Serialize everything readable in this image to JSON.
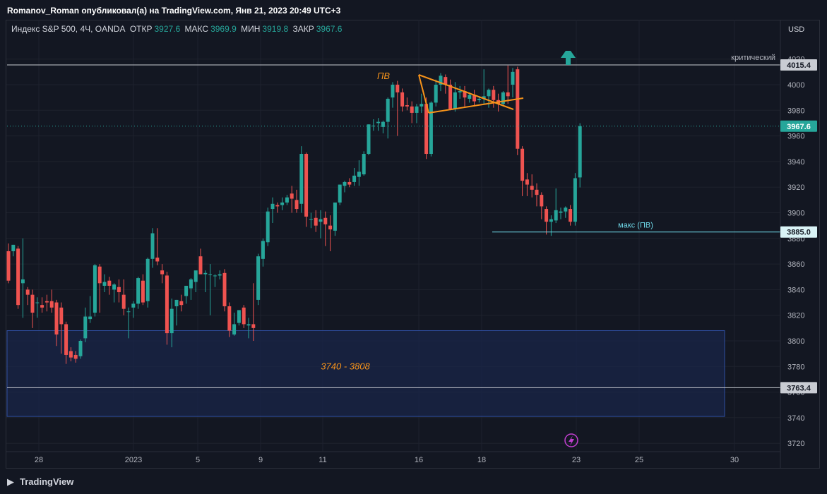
{
  "header": {
    "publish_line": "Romanov_Roman опубликовал(а) на TradingView.com, Янв 21, 2023 20:49 UTC+3"
  },
  "legend": {
    "symbol": "Индекс S&P 500, 4Ч, OANDA",
    "open_label": "ОТКР",
    "open_value": "3927.6",
    "high_label": "МАКС",
    "high_value": "3969.9",
    "low_label": "МИН",
    "low_value": "3919.8",
    "close_label": "ЗАКР",
    "close_value": "3967.6"
  },
  "footer": {
    "brand": "TradingView"
  },
  "colors": {
    "up": "#26a69a",
    "down": "#ef5350",
    "orange": "#f7931a",
    "zone_fill": "#1a2548",
    "zone_border": "#2f4ea0",
    "cyan": "#6fd8e8"
  },
  "chart_data": {
    "type": "candlestick",
    "currency": "USD",
    "ylim": [
      3712,
      4034
    ],
    "y_ticks": [
      3720,
      3740,
      3760,
      3780,
      3800,
      3820,
      3840,
      3860,
      3880,
      3900,
      3920,
      3940,
      3960,
      3980,
      4000,
      4020
    ],
    "x_ticks": [
      "28",
      "2023",
      "5",
      "9",
      "11",
      "16",
      "18",
      "23",
      "25",
      "30"
    ],
    "current_price": "3967.6",
    "levels": [
      {
        "name": "critical",
        "price": 4015.4,
        "label": "критический",
        "tag": "4015.4"
      },
      {
        "name": "max-pv",
        "price": 3885.0,
        "label": "макс (ПВ)",
        "tag": "3885.0"
      },
      {
        "name": "zone-bottom",
        "price": 3763.4,
        "label": "",
        "tag": "3763.4"
      }
    ],
    "zone": {
      "low": 3741,
      "high": 3808,
      "label": "3740 - 3808"
    },
    "triangle_label": "ПВ",
    "candles": [
      [
        3870,
        3876,
        3845,
        3847
      ],
      [
        3870,
        3875,
        3866,
        3875
      ],
      [
        3872,
        3874,
        3825,
        3828
      ],
      [
        3845,
        3880,
        3818,
        3848
      ],
      [
        3840,
        3842,
        3828,
        3836
      ],
      [
        3836,
        3840,
        3810,
        3822
      ],
      [
        3830,
        3834,
        3818,
        3830
      ],
      [
        3828,
        3834,
        3822,
        3826
      ],
      [
        3831,
        3836,
        3823,
        3830
      ],
      [
        3831,
        3840,
        3822,
        3826
      ],
      [
        3830,
        3832,
        3796,
        3805
      ],
      [
        3826,
        3830,
        3790,
        3813
      ],
      [
        3813,
        3815,
        3782,
        3789
      ],
      [
        3792,
        3795,
        3784,
        3787
      ],
      [
        3789,
        3792,
        3783,
        3786
      ],
      [
        3788,
        3801,
        3786,
        3800
      ],
      [
        3802,
        3826,
        3799,
        3819
      ],
      [
        3817,
        3835,
        3814,
        3819
      ],
      [
        3822,
        3860,
        3819,
        3859
      ],
      [
        3858,
        3860,
        3822,
        3845
      ],
      [
        3843,
        3852,
        3838,
        3846
      ],
      [
        3847,
        3850,
        3836,
        3843
      ],
      [
        3840,
        3845,
        3830,
        3844
      ],
      [
        3842,
        3848,
        3830,
        3838
      ],
      [
        3836,
        3848,
        3820,
        3825
      ],
      [
        3823,
        3826,
        3802,
        3823
      ],
      [
        3826,
        3831,
        3818,
        3829
      ],
      [
        3829,
        3850,
        3825,
        3849
      ],
      [
        3847,
        3852,
        3828,
        3830
      ],
      [
        3831,
        3865,
        3826,
        3864
      ],
      [
        3864,
        3888,
        3857,
        3884
      ],
      [
        3865,
        3888,
        3859,
        3862
      ],
      [
        3855,
        3860,
        3845,
        3852
      ],
      [
        3851,
        3854,
        3797,
        3806
      ],
      [
        3806,
        3833,
        3795,
        3825
      ],
      [
        3827,
        3832,
        3812,
        3832
      ],
      [
        3831,
        3836,
        3823,
        3828
      ],
      [
        3835,
        3843,
        3829,
        3843
      ],
      [
        3841,
        3849,
        3832,
        3848
      ],
      [
        3846,
        3854,
        3838,
        3855
      ],
      [
        3866,
        3872,
        3852,
        3852
      ],
      [
        3852,
        3855,
        3838,
        3853
      ],
      [
        3852,
        3860,
        3820,
        3852
      ],
      [
        3851,
        3852,
        3842,
        3851
      ],
      [
        3851,
        3855,
        3848,
        3852
      ],
      [
        3853,
        3856,
        3823,
        3827
      ],
      [
        3827,
        3830,
        3803,
        3808
      ],
      [
        3805,
        3822,
        3804,
        3813
      ],
      [
        3814,
        3824,
        3812,
        3824
      ],
      [
        3826,
        3828,
        3810,
        3813
      ],
      [
        3812,
        3818,
        3802,
        3813
      ],
      [
        3813,
        3845,
        3800,
        3810
      ],
      [
        3832,
        3868,
        3828,
        3866
      ],
      [
        3864,
        3880,
        3858,
        3878
      ],
      [
        3877,
        3904,
        3874,
        3901
      ],
      [
        3903,
        3912,
        3892,
        3907
      ],
      [
        3906,
        3908,
        3900,
        3905
      ],
      [
        3906,
        3912,
        3902,
        3908
      ],
      [
        3908,
        3914,
        3906,
        3912
      ],
      [
        3915,
        3921,
        3900,
        3911
      ],
      [
        3910,
        3918,
        3900,
        3903
      ],
      [
        3907,
        3952,
        3900,
        3946
      ],
      [
        3946,
        3947,
        3889,
        3897
      ],
      [
        3895,
        3900,
        3888,
        3895
      ],
      [
        3896,
        3902,
        3885,
        3890
      ],
      [
        3893,
        3902,
        3880,
        3895
      ],
      [
        3896,
        3901,
        3874,
        3891
      ],
      [
        3890,
        3898,
        3870,
        3887
      ],
      [
        3886,
        3908,
        3882,
        3908
      ],
      [
        3908,
        3922,
        3906,
        3922
      ],
      [
        3921,
        3925,
        3916,
        3924
      ],
      [
        3924,
        3927,
        3920,
        3922
      ],
      [
        3924,
        3935,
        3921,
        3929
      ],
      [
        3928,
        3941,
        3921,
        3932
      ],
      [
        3930,
        3948,
        3929,
        3946
      ],
      [
        3946,
        3969,
        3945,
        3969
      ],
      [
        3968,
        3973,
        3964,
        3968
      ],
      [
        3970,
        3974,
        3964,
        3971
      ],
      [
        3967,
        3972,
        3962,
        3971
      ],
      [
        3971,
        3990,
        3958,
        3989
      ],
      [
        3990,
        4002,
        3982,
        4000
      ],
      [
        4000,
        4003,
        3960,
        3994
      ],
      [
        3994,
        3997,
        3979,
        3983
      ],
      [
        3984,
        3990,
        3980,
        3983
      ],
      [
        3983,
        3987,
        3970,
        3978
      ],
      [
        3978,
        3985,
        3970,
        3983
      ],
      [
        3983,
        3993,
        3978,
        3985
      ],
      [
        3985,
        3990,
        3942,
        3946
      ],
      [
        3946,
        3987,
        3944,
        3986
      ],
      [
        3986,
        4004,
        3983,
        4000
      ],
      [
        4000,
        4009,
        3995,
        4007
      ],
      [
        4006,
        4008,
        3993,
        4000
      ],
      [
        4000,
        4004,
        3980,
        3981
      ],
      [
        3981,
        4002,
        3979,
        3994
      ],
      [
        3994,
        3999,
        3989,
        3995
      ],
      [
        3995,
        3999,
        3983,
        3990
      ],
      [
        3989,
        3994,
        3986,
        3992
      ],
      [
        3992,
        3996,
        3983,
        3987
      ],
      [
        3988,
        3991,
        3986,
        3989
      ],
      [
        3989,
        4012,
        3985,
        3991
      ],
      [
        3991,
        3997,
        3982,
        3996
      ],
      [
        3996,
        3999,
        3982,
        3988
      ],
      [
        3988,
        3993,
        3979,
        3985
      ],
      [
        3985,
        3995,
        3984,
        3994
      ],
      [
        3994,
        4015,
        3985,
        3991
      ],
      [
        4000,
        4013,
        3990,
        4010
      ],
      [
        4012,
        4014,
        3945,
        3950
      ],
      [
        3950,
        3952,
        3913,
        3925
      ],
      [
        3926,
        3931,
        3913,
        3922
      ],
      [
        3921,
        3930,
        3912,
        3918
      ],
      [
        3918,
        3923,
        3905,
        3914
      ],
      [
        3914,
        3916,
        3895,
        3905
      ],
      [
        3903,
        3905,
        3883,
        3893
      ],
      [
        3893,
        3898,
        3882,
        3895
      ],
      [
        3894,
        3919,
        3892,
        3902
      ],
      [
        3900,
        3904,
        3895,
        3901
      ],
      [
        3901,
        3905,
        3896,
        3904
      ],
      [
        3903,
        3906,
        3890,
        3893
      ],
      [
        3893,
        3931,
        3890,
        3927
      ],
      [
        3927.6,
        3969.9,
        3919.8,
        3967.6
      ]
    ]
  }
}
